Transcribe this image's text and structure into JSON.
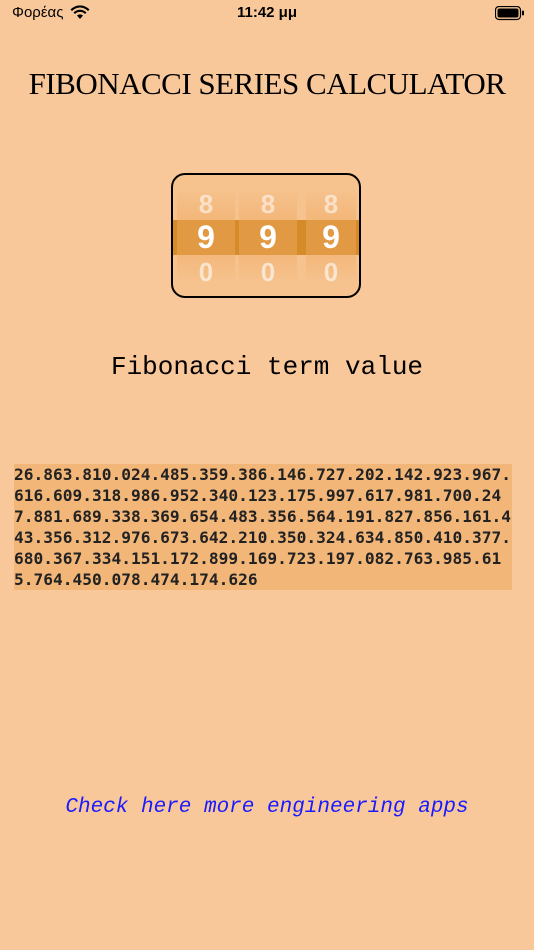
{
  "status_bar": {
    "carrier": "Φορέας",
    "time": "11:42 μμ",
    "wifi_icon": "wifi-icon",
    "battery_icon": "battery-icon"
  },
  "title": "FIBONACCI SERIES CALCULATOR",
  "picker": {
    "wheels": [
      {
        "prev": "8",
        "current": "9",
        "next": "0"
      },
      {
        "prev": "8",
        "current": "9",
        "next": "0"
      },
      {
        "prev": "8",
        "current": "9",
        "next": "0"
      }
    ],
    "selection_color": "#d58b28"
  },
  "term_label": "Fibonacci term value",
  "result_value": "26.863.810.024.485.359.386.146.727.202.142.923.967.616.609.318.986.952.340.123.175.997.617.981.700.247.881.689.338.369.654.483.356.564.191.827.856.161.443.356.312.976.673.642.210.350.324.634.850.410.377.680.367.334.151.172.899.169.723.197.082.763.985.615.764.450.078.474.174.626",
  "link_text": "Check here more engineering apps",
  "colors": {
    "background": "#f9c89a",
    "result_background": "#f2b679",
    "link": "#1a1aff"
  }
}
